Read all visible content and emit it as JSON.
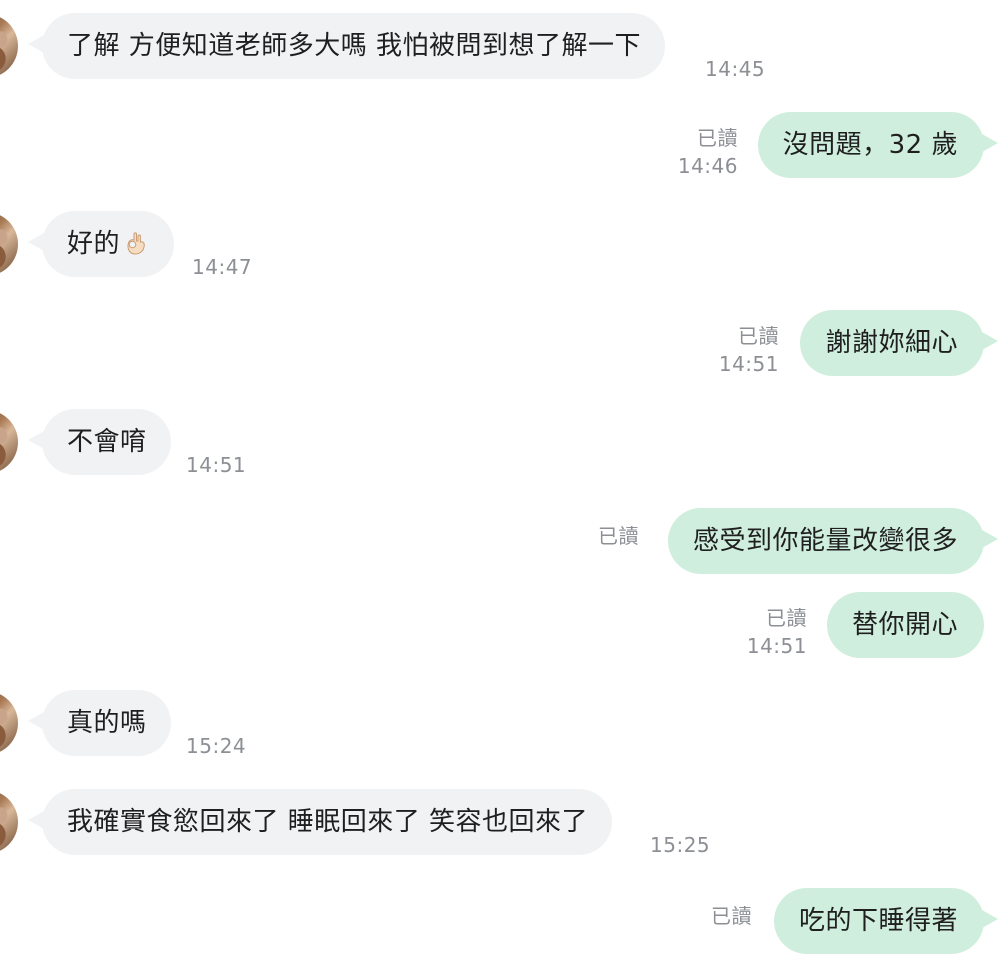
{
  "messages": [
    {
      "side": "in",
      "text": "了解 方便知道老師多大嗎 我怕被問到想了解一下",
      "time": "14:45"
    },
    {
      "side": "out",
      "text": "沒問題，32 歲",
      "read": "已讀",
      "time": "14:46"
    },
    {
      "side": "in",
      "text": "好的",
      "emoji": "ok-hand-icon",
      "time": "14:47"
    },
    {
      "side": "out",
      "text": "謝謝妳細心",
      "read": "已讀",
      "time": "14:51"
    },
    {
      "side": "in",
      "text": "不會唷",
      "time": "14:51"
    },
    {
      "side": "out",
      "text": "感受到你能量改變很多",
      "read": "已讀",
      "time": ""
    },
    {
      "side": "out",
      "text": "替你開心",
      "read": "已讀",
      "time": "14:51"
    },
    {
      "side": "in",
      "text": "真的嗎",
      "time": "15:24"
    },
    {
      "side": "in",
      "text": "我確實食慾回來了 睡眠回來了 笑容也回來了",
      "time": "15:25"
    },
    {
      "side": "out",
      "text": "吃的下睡得著",
      "read": "已讀",
      "time": ""
    }
  ],
  "colors": {
    "incoming_bubble": "#f1f2f4",
    "outgoing_bubble": "#cfeedd",
    "meta_text": "#8c8f94"
  }
}
